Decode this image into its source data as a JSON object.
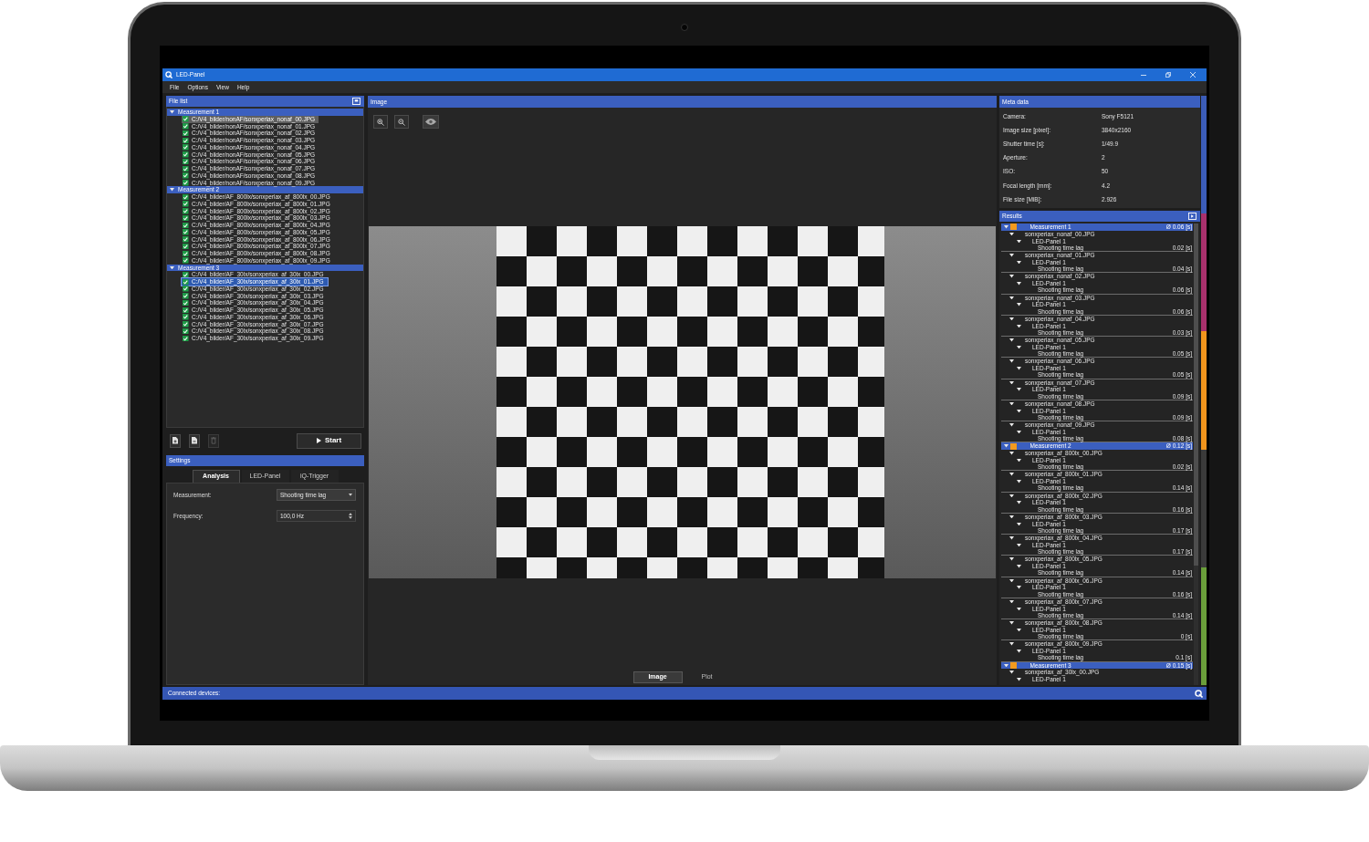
{
  "window": {
    "title": "LED-Panel"
  },
  "menu": [
    "File",
    "Options",
    "View",
    "Help"
  ],
  "file_list": {
    "title": "File list",
    "groups": [
      {
        "name": "Measurement 1",
        "expanded": true,
        "files": [
          {
            "path": "C:/V4_bilder/nonAF/sonxperiax_nonaf_00.JPG",
            "checked": true,
            "selected": false,
            "hovered": true
          },
          {
            "path": "C:/V4_bilder/nonAF/sonxperiax_nonaf_01.JPG",
            "checked": true,
            "selected": false,
            "hovered": false
          },
          {
            "path": "C:/V4_bilder/nonAF/sonxperiax_nonaf_02.JPG",
            "checked": true,
            "selected": false,
            "hovered": false
          },
          {
            "path": "C:/V4_bilder/nonAF/sonxperiax_nonaf_03.JPG",
            "checked": true,
            "selected": false,
            "hovered": false
          },
          {
            "path": "C:/V4_bilder/nonAF/sonxperiax_nonaf_04.JPG",
            "checked": true,
            "selected": false,
            "hovered": false
          },
          {
            "path": "C:/V4_bilder/nonAF/sonxperiax_nonaf_05.JPG",
            "checked": true,
            "selected": false,
            "hovered": false
          },
          {
            "path": "C:/V4_bilder/nonAF/sonxperiax_nonaf_06.JPG",
            "checked": true,
            "selected": false,
            "hovered": false
          },
          {
            "path": "C:/V4_bilder/nonAF/sonxperiax_nonaf_07.JPG",
            "checked": true,
            "selected": false,
            "hovered": false
          },
          {
            "path": "C:/V4_bilder/nonAF/sonxperiax_nonaf_08.JPG",
            "checked": true,
            "selected": false,
            "hovered": false
          },
          {
            "path": "C:/V4_bilder/nonAF/sonxperiax_nonaf_09.JPG",
            "checked": true,
            "selected": false,
            "hovered": false
          }
        ]
      },
      {
        "name": "Measurement 2",
        "expanded": true,
        "files": [
          {
            "path": "C:/V4_bilder/AF_800lx/sonxperiax_af_800lx_00.JPG",
            "checked": true,
            "selected": false,
            "hovered": false
          },
          {
            "path": "C:/V4_bilder/AF_800lx/sonxperiax_af_800lx_01.JPG",
            "checked": true,
            "selected": false,
            "hovered": false
          },
          {
            "path": "C:/V4_bilder/AF_800lx/sonxperiax_af_800lx_02.JPG",
            "checked": true,
            "selected": false,
            "hovered": false
          },
          {
            "path": "C:/V4_bilder/AF_800lx/sonxperiax_af_800lx_03.JPG",
            "checked": true,
            "selected": false,
            "hovered": false
          },
          {
            "path": "C:/V4_bilder/AF_800lx/sonxperiax_af_800lx_04.JPG",
            "checked": true,
            "selected": false,
            "hovered": false
          },
          {
            "path": "C:/V4_bilder/AF_800lx/sonxperiax_af_800lx_05.JPG",
            "checked": true,
            "selected": false,
            "hovered": false
          },
          {
            "path": "C:/V4_bilder/AF_800lx/sonxperiax_af_800lx_06.JPG",
            "checked": true,
            "selected": false,
            "hovered": false
          },
          {
            "path": "C:/V4_bilder/AF_800lx/sonxperiax_af_800lx_07.JPG",
            "checked": true,
            "selected": false,
            "hovered": false
          },
          {
            "path": "C:/V4_bilder/AF_800lx/sonxperiax_af_800lx_08.JPG",
            "checked": true,
            "selected": false,
            "hovered": false
          },
          {
            "path": "C:/V4_bilder/AF_800lx/sonxperiax_af_800lx_09.JPG",
            "checked": true,
            "selected": false,
            "hovered": false
          }
        ]
      },
      {
        "name": "Measurement 3",
        "expanded": true,
        "files": [
          {
            "path": "C:/V4_bilder/AF_30lx/sonxperiax_af_30lx_00.JPG",
            "checked": true,
            "selected": false,
            "hovered": false
          },
          {
            "path": "C:/V4_bilder/AF_30lx/sonxperiax_af_30lx_01.JPG",
            "checked": true,
            "selected": true,
            "hovered": false
          },
          {
            "path": "C:/V4_bilder/AF_30lx/sonxperiax_af_30lx_02.JPG",
            "checked": true,
            "selected": false,
            "hovered": false
          },
          {
            "path": "C:/V4_bilder/AF_30lx/sonxperiax_af_30lx_03.JPG",
            "checked": true,
            "selected": false,
            "hovered": false
          },
          {
            "path": "C:/V4_bilder/AF_30lx/sonxperiax_af_30lx_04.JPG",
            "checked": true,
            "selected": false,
            "hovered": false
          },
          {
            "path": "C:/V4_bilder/AF_30lx/sonxperiax_af_30lx_05.JPG",
            "checked": true,
            "selected": false,
            "hovered": false
          },
          {
            "path": "C:/V4_bilder/AF_30lx/sonxperiax_af_30lx_06.JPG",
            "checked": true,
            "selected": false,
            "hovered": false
          },
          {
            "path": "C:/V4_bilder/AF_30lx/sonxperiax_af_30lx_07.JPG",
            "checked": true,
            "selected": false,
            "hovered": false
          },
          {
            "path": "C:/V4_bilder/AF_30lx/sonxperiax_af_30lx_08.JPG",
            "checked": true,
            "selected": false,
            "hovered": false
          },
          {
            "path": "C:/V4_bilder/AF_30lx/sonxperiax_af_30lx_09.JPG",
            "checked": true,
            "selected": false,
            "hovered": false
          }
        ]
      }
    ]
  },
  "file_toolbar": [
    {
      "kind": "new",
      "disabled": false
    },
    {
      "kind": "file",
      "disabled": false
    },
    {
      "kind": "delete",
      "disabled": true
    }
  ],
  "start_button": {
    "label": "Start"
  },
  "settings": {
    "title": "Settings",
    "tabs": [
      {
        "label": "Analysis",
        "selected": true
      },
      {
        "label": "LED-Panel",
        "selected": false
      },
      {
        "label": "iQ-Trigger",
        "selected": false
      }
    ],
    "fields": [
      {
        "kind": "dropdown",
        "label": "Measurement:",
        "value": "Shooting time lag"
      },
      {
        "kind": "spinbox",
        "label": "Frequency:",
        "value": "100,0 Hz"
      }
    ]
  },
  "image_panel": {
    "title": "Image",
    "tabs": [
      {
        "label": "Image",
        "selected": true
      },
      {
        "label": "Plot",
        "selected": false
      }
    ]
  },
  "meta_data": {
    "title": "Meta data",
    "rows": [
      {
        "label": "Camera:",
        "value": "Sony F5121"
      },
      {
        "label": "Image size [pixel]:",
        "value": "3840x2160"
      },
      {
        "label": "Shutter time [s]:",
        "value": "1/49.9"
      },
      {
        "label": "Aperture:",
        "value": "2"
      },
      {
        "label": "ISO:",
        "value": "50"
      },
      {
        "label": "Focal length [mm]:",
        "value": "4.2"
      },
      {
        "label": "File size [MiB]:",
        "value": "2.926"
      }
    ]
  },
  "results": {
    "title": "Results",
    "measurements": [
      {
        "name": "Measurement 1",
        "average": "Ø 0.06 [s]",
        "expanded": true,
        "color": "#f39a1e",
        "files": [
          {
            "name": "sonxperiax_nonaf_00.JPG",
            "expanded": true,
            "panels": [
              {
                "name": "LED-Panel 1",
                "expanded": true,
                "results": [
                  {
                    "label": "Shooting time lag",
                    "value": "0.02 [s]"
                  }
                ]
              }
            ]
          },
          {
            "name": "sonxperiax_nonaf_01.JPG",
            "expanded": true,
            "panels": [
              {
                "name": "LED-Panel 1",
                "expanded": true,
                "results": [
                  {
                    "label": "Shooting time lag",
                    "value": "0.04 [s]"
                  }
                ]
              }
            ]
          },
          {
            "name": "sonxperiax_nonaf_02.JPG",
            "expanded": true,
            "panels": [
              {
                "name": "LED-Panel 1",
                "expanded": true,
                "results": [
                  {
                    "label": "Shooting time lag",
                    "value": "0.06 [s]"
                  }
                ]
              }
            ]
          },
          {
            "name": "sonxperiax_nonaf_03.JPG",
            "expanded": true,
            "panels": [
              {
                "name": "LED-Panel 1",
                "expanded": true,
                "results": [
                  {
                    "label": "Shooting time lag",
                    "value": "0.06 [s]"
                  }
                ]
              }
            ]
          },
          {
            "name": "sonxperiax_nonaf_04.JPG",
            "expanded": true,
            "panels": [
              {
                "name": "LED-Panel 1",
                "expanded": true,
                "results": [
                  {
                    "label": "Shooting time lag",
                    "value": "0.03 [s]"
                  }
                ]
              }
            ]
          },
          {
            "name": "sonxperiax_nonaf_05.JPG",
            "expanded": true,
            "panels": [
              {
                "name": "LED-Panel 1",
                "expanded": true,
                "results": [
                  {
                    "label": "Shooting time lag",
                    "value": "0.05 [s]"
                  }
                ]
              }
            ]
          },
          {
            "name": "sonxperiax_nonaf_06.JPG",
            "expanded": true,
            "panels": [
              {
                "name": "LED-Panel 1",
                "expanded": true,
                "results": [
                  {
                    "label": "Shooting time lag",
                    "value": "0.05 [s]"
                  }
                ]
              }
            ]
          },
          {
            "name": "sonxperiax_nonaf_07.JPG",
            "expanded": true,
            "panels": [
              {
                "name": "LED-Panel 1",
                "expanded": true,
                "results": [
                  {
                    "label": "Shooting time lag",
                    "value": "0.09 [s]"
                  }
                ]
              }
            ]
          },
          {
            "name": "sonxperiax_nonaf_08.JPG",
            "expanded": true,
            "panels": [
              {
                "name": "LED-Panel 1",
                "expanded": true,
                "results": [
                  {
                    "label": "Shooting time lag",
                    "value": "0.09 [s]"
                  }
                ]
              }
            ]
          },
          {
            "name": "sonxperiax_nonaf_09.JPG",
            "expanded": true,
            "panels": [
              {
                "name": "LED-Panel 1",
                "expanded": true,
                "results": [
                  {
                    "label": "Shooting time lag",
                    "value": "0.08 [s]"
                  }
                ]
              }
            ]
          }
        ]
      },
      {
        "name": "Measurement 2",
        "average": "Ø 0.12 [s]",
        "expanded": true,
        "color": "#f39a1e",
        "files": [
          {
            "name": "sonxperiax_af_800lx_00.JPG",
            "expanded": true,
            "panels": [
              {
                "name": "LED-Panel 1",
                "expanded": true,
                "results": [
                  {
                    "label": "Shooting time lag",
                    "value": "0.02 [s]"
                  }
                ]
              }
            ]
          },
          {
            "name": "sonxperiax_af_800lx_01.JPG",
            "expanded": true,
            "panels": [
              {
                "name": "LED-Panel 1",
                "expanded": true,
                "results": [
                  {
                    "label": "Shooting time lag",
                    "value": "0.14 [s]"
                  }
                ]
              }
            ]
          },
          {
            "name": "sonxperiax_af_800lx_02.JPG",
            "expanded": true,
            "panels": [
              {
                "name": "LED-Panel 1",
                "expanded": true,
                "results": [
                  {
                    "label": "Shooting time lag",
                    "value": "0.16 [s]"
                  }
                ]
              }
            ]
          },
          {
            "name": "sonxperiax_af_800lx_03.JPG",
            "expanded": true,
            "panels": [
              {
                "name": "LED-Panel 1",
                "expanded": true,
                "results": [
                  {
                    "label": "Shooting time lag",
                    "value": "0.17 [s]"
                  }
                ]
              }
            ]
          },
          {
            "name": "sonxperiax_af_800lx_04.JPG",
            "expanded": true,
            "panels": [
              {
                "name": "LED-Panel 1",
                "expanded": true,
                "results": [
                  {
                    "label": "Shooting time lag",
                    "value": "0.17 [s]"
                  }
                ]
              }
            ]
          },
          {
            "name": "sonxperiax_af_800lx_05.JPG",
            "expanded": true,
            "panels": [
              {
                "name": "LED-Panel 1",
                "expanded": true,
                "results": [
                  {
                    "label": "Shooting time lag",
                    "value": "0.14 [s]"
                  }
                ]
              }
            ]
          },
          {
            "name": "sonxperiax_af_800lx_06.JPG",
            "expanded": true,
            "panels": [
              {
                "name": "LED-Panel 1",
                "expanded": true,
                "results": [
                  {
                    "label": "Shooting time lag",
                    "value": "0.16 [s]"
                  }
                ]
              }
            ]
          },
          {
            "name": "sonxperiax_af_800lx_07.JPG",
            "expanded": true,
            "panels": [
              {
                "name": "LED-Panel 1",
                "expanded": true,
                "results": [
                  {
                    "label": "Shooting time lag",
                    "value": "0.14 [s]"
                  }
                ]
              }
            ]
          },
          {
            "name": "sonxperiax_af_800lx_08.JPG",
            "expanded": true,
            "panels": [
              {
                "name": "LED-Panel 1",
                "expanded": true,
                "results": [
                  {
                    "label": "Shooting time lag",
                    "value": "0 [s]"
                  }
                ]
              }
            ]
          },
          {
            "name": "sonxperiax_af_800lx_09.JPG",
            "expanded": true,
            "panels": [
              {
                "name": "LED-Panel 1",
                "expanded": true,
                "results": [
                  {
                    "label": "Shooting time lag",
                    "value": "0.1 [s]"
                  }
                ]
              }
            ]
          }
        ]
      },
      {
        "name": "Measurement 3",
        "average": "Ø 0.15 [s]",
        "expanded": true,
        "color": "#f39a1e",
        "files": [
          {
            "name": "sonxperiax_af_30lx_00.JPG",
            "expanded": true,
            "panels": [
              {
                "name": "LED-Panel 1",
                "expanded": true
              }
            ]
          }
        ]
      }
    ]
  },
  "side_strip": [
    {
      "color": "#3b5cb8"
    },
    {
      "color": "#a8306c"
    },
    {
      "color": "#f0941c"
    },
    {
      "color": "#3a3a3a"
    },
    {
      "color": "#6a9e3a"
    }
  ],
  "status_bar": {
    "text": "Connected devices:"
  }
}
